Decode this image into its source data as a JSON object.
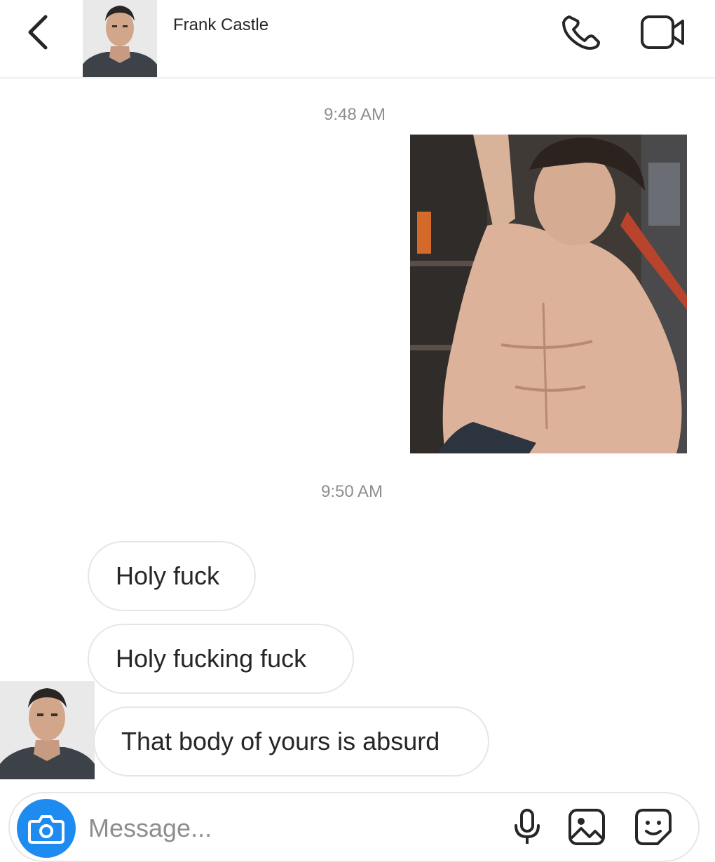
{
  "header": {
    "contact_name": "Frank Castle",
    "back_icon": "chevron-left-icon",
    "call_icon": "phone-icon",
    "video_icon": "video-camera-icon"
  },
  "thread": {
    "timestamps": [
      "9:48 AM",
      "9:50 AM"
    ],
    "messages": [
      {
        "text": "Holy fuck"
      },
      {
        "text": "Holy fucking fuck"
      },
      {
        "text": "That body of yours is absurd"
      }
    ]
  },
  "composer": {
    "placeholder": "Message...",
    "value": "",
    "camera_icon": "camera-icon",
    "mic_icon": "microphone-icon",
    "gallery_icon": "image-icon",
    "sticker_icon": "sticker-icon"
  },
  "colors": {
    "accent": "#1d8bf0",
    "bubble_border": "#e6e6e6",
    "muted_text": "#8e8e8e",
    "primary_text": "#262626"
  }
}
